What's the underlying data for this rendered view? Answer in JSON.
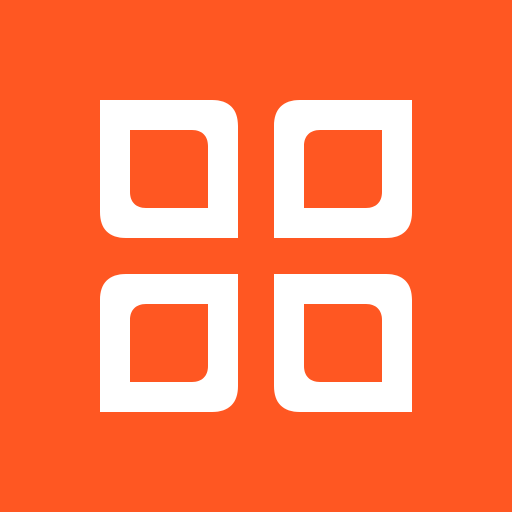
{
  "icon": {
    "name": "four-leaf-grid-icon",
    "background_color": "#ff5722",
    "foreground_color": "#ffffff"
  }
}
